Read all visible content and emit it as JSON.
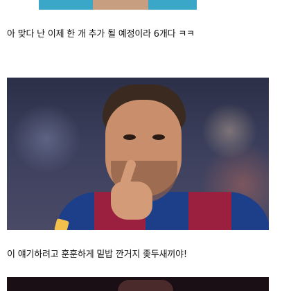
{
  "posts": {
    "caption_1": "아 맞다 난 이제 한 개 추가 될 예정이라 6개다 ㅋㅋ",
    "caption_2": "이 얘기하려고 훈훈하게 밑밥 깐거지 좆두새끼야!"
  },
  "icons": {
    "photo_icon": "photo-icon"
  },
  "colors": {
    "background": "#ffffff",
    "jersey_blue": "#1d3f8a",
    "jersey_red": "#9b1f3e",
    "top_photo_accent": "#3aa6c8"
  }
}
